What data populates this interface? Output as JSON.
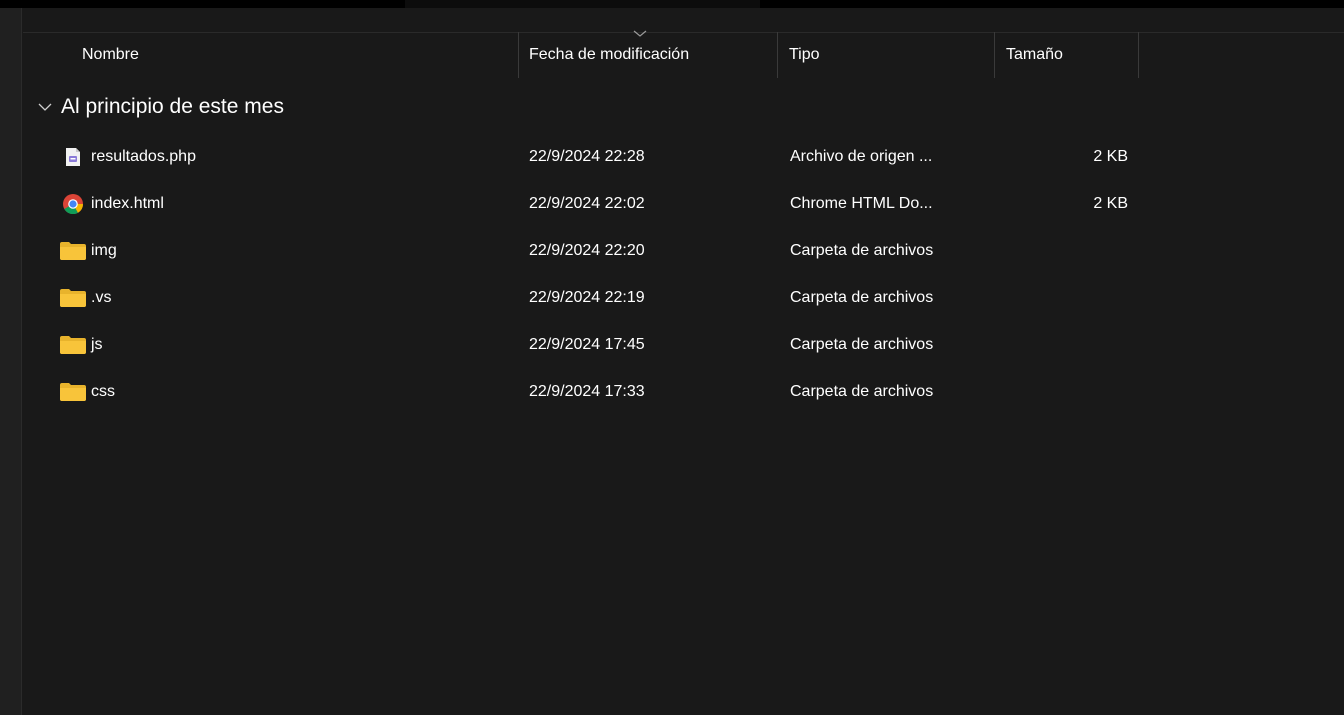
{
  "columns": {
    "name": "Nombre",
    "modified": "Fecha de modificación",
    "type": "Tipo",
    "size": "Tamaño"
  },
  "group": {
    "label": "Al principio de este mes"
  },
  "files": [
    {
      "name": "resultados.php",
      "modified": "22/9/2024 22:28",
      "type": "Archivo de origen ...",
      "size": "2 KB",
      "icon": "php-file-icon"
    },
    {
      "name": "index.html",
      "modified": "22/9/2024 22:02",
      "type": "Chrome HTML Do...",
      "size": "2 KB",
      "icon": "chrome-icon"
    },
    {
      "name": "img",
      "modified": "22/9/2024 22:20",
      "type": "Carpeta de archivos",
      "size": "",
      "icon": "folder-icon"
    },
    {
      "name": ".vs",
      "modified": "22/9/2024 22:19",
      "type": "Carpeta de archivos",
      "size": "",
      "icon": "folder-icon"
    },
    {
      "name": "js",
      "modified": "22/9/2024 17:45",
      "type": "Carpeta de archivos",
      "size": "",
      "icon": "folder-icon"
    },
    {
      "name": "css",
      "modified": "22/9/2024 17:33",
      "type": "Carpeta de archivos",
      "size": "",
      "icon": "folder-icon"
    }
  ],
  "colors": {
    "background": "#191919",
    "folder": "#f8c43a",
    "text": "#ffffff"
  }
}
